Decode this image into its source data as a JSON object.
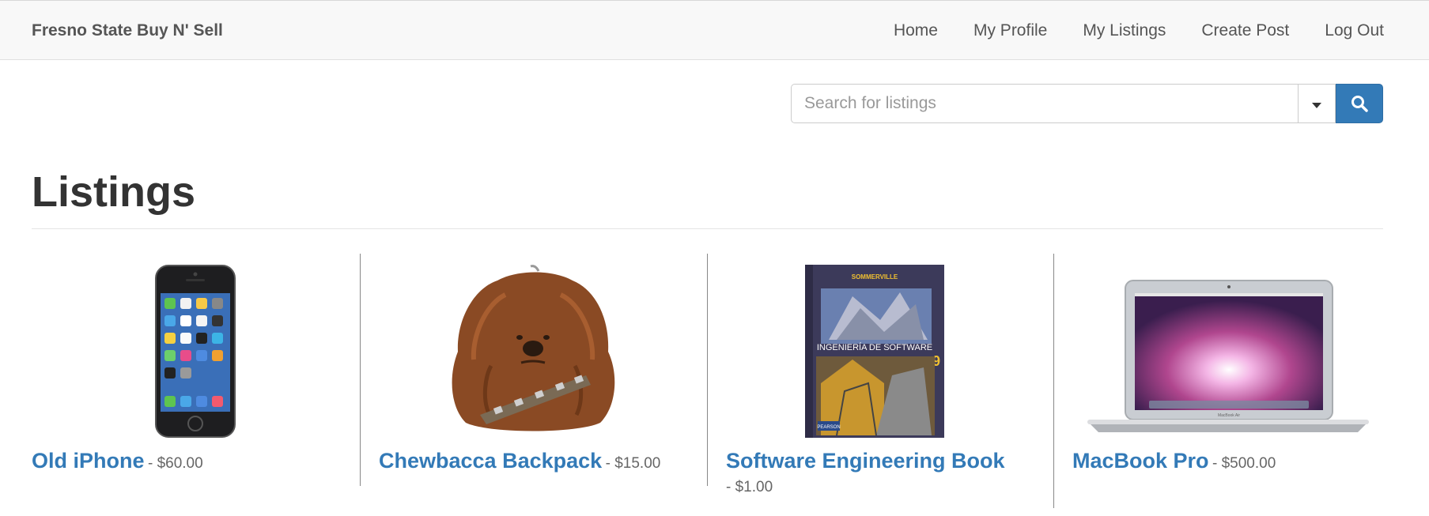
{
  "navbar": {
    "brand": "Fresno State Buy N' Sell",
    "links": [
      "Home",
      "My Profile",
      "My Listings",
      "Create Post",
      "Log Out"
    ]
  },
  "search": {
    "placeholder": "Search for listings",
    "dropdown_icon": "caret-down-icon",
    "button_icon": "search-icon",
    "button_color": "#337ab7"
  },
  "page": {
    "title": "Listings"
  },
  "listings": [
    {
      "name": "Old iPhone",
      "price": "- $60.00",
      "image": "iphone-image"
    },
    {
      "name": "Chewbacca Backpack",
      "price": "- $15.00",
      "image": "chewbacca-backpack-image"
    },
    {
      "name": "Software Engineering Book",
      "price": "- $1.00",
      "image": "software-engineering-book-image",
      "book_cover": {
        "author": "SOMMERVILLE",
        "title": "INGENIERÍA DE SOFTWARE",
        "edition": "9",
        "publisher": "PEARSON"
      }
    },
    {
      "name": "MacBook Pro",
      "price": "- $500.00",
      "image": "macbook-image",
      "laptop_label": "MacBook Air"
    }
  ]
}
